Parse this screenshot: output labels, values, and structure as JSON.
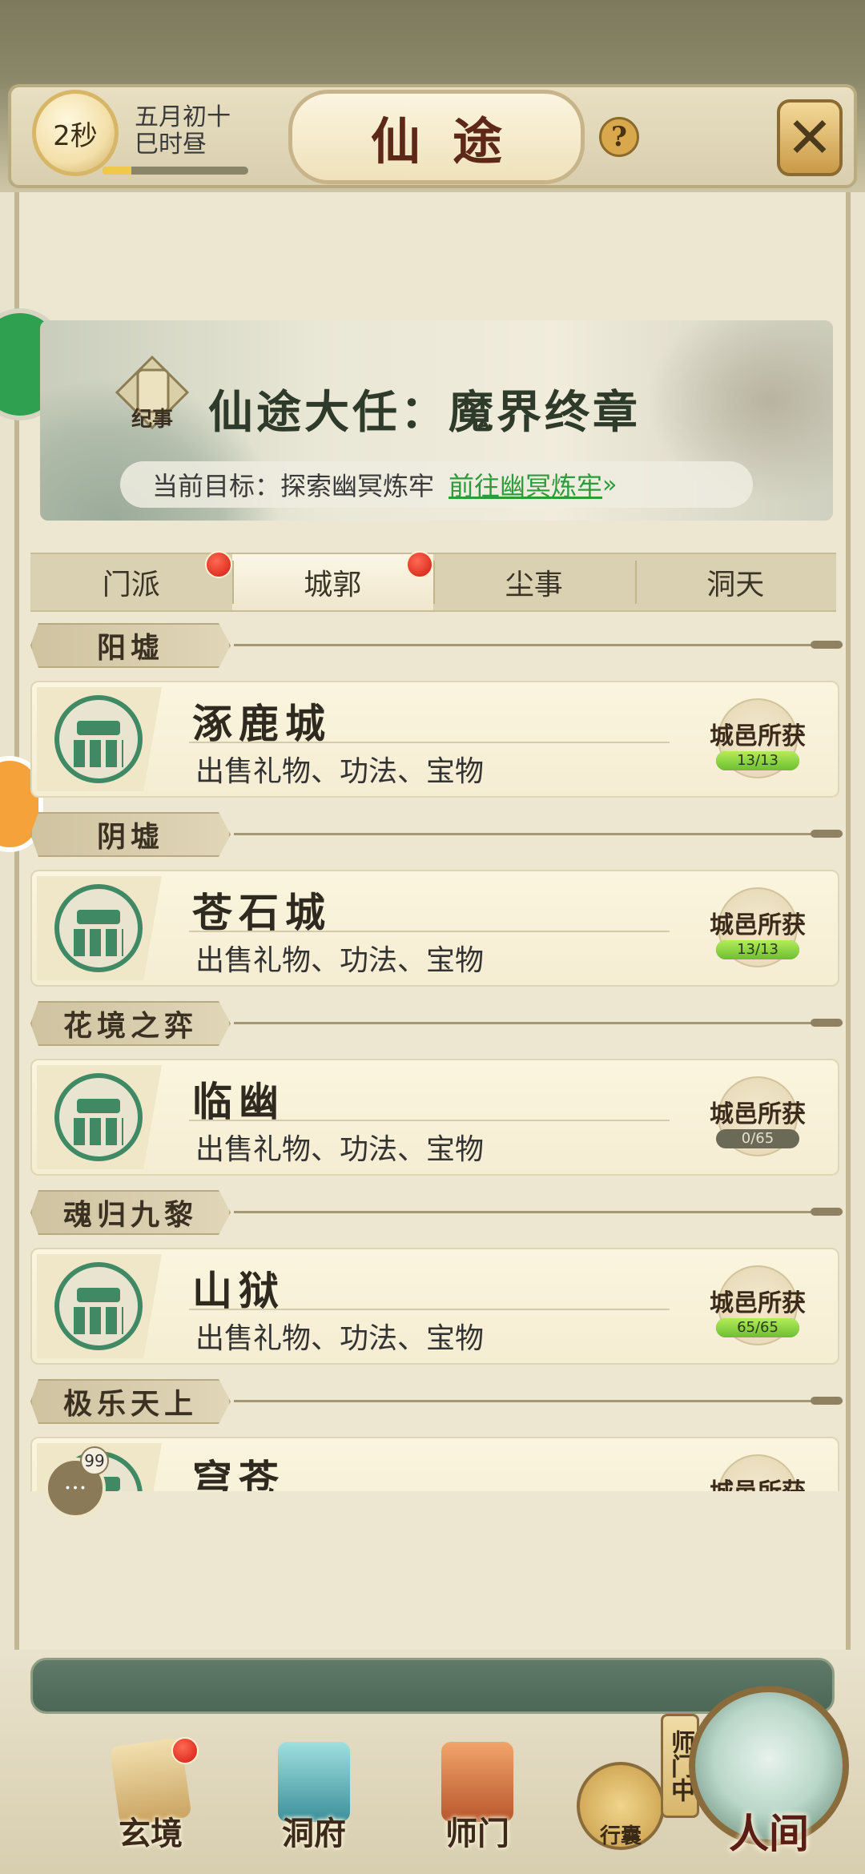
{
  "header": {
    "timer": "2秒",
    "date_line1": "五月初十",
    "date_line2": "巳时昼",
    "time_progress": 0.2,
    "title": "仙途",
    "help_icon": "question-icon",
    "close_icon": "close-icon"
  },
  "banner": {
    "badge": "纪事",
    "title": "仙途大任：魔界终章",
    "goal_label": "当前目标：探索幽冥炼牢",
    "goal_link": "前往幽冥炼牢"
  },
  "tabs": [
    {
      "label": "门派",
      "active": false,
      "dot": true
    },
    {
      "label": "城郭",
      "active": true,
      "dot": true
    },
    {
      "label": "尘事",
      "active": false,
      "dot": false
    },
    {
      "label": "洞天",
      "active": false,
      "dot": false
    }
  ],
  "sections": [
    {
      "name": "阳墟",
      "city": {
        "name": "涿鹿城",
        "desc": "出售礼物、功法、宝物",
        "harvest_label": "城邑所获",
        "harvest_text": "13/13",
        "harvest_fraction": 1.0
      }
    },
    {
      "name": "阴墟",
      "city": {
        "name": "苍石城",
        "desc": "出售礼物、功法、宝物",
        "harvest_label": "城邑所获",
        "harvest_text": "13/13",
        "harvest_fraction": 1.0
      }
    },
    {
      "name": "花境之弈",
      "city": {
        "name": "临幽",
        "desc": "出售礼物、功法、宝物",
        "harvest_label": "城邑所获",
        "harvest_text": "0/65",
        "harvest_fraction": 0.0
      }
    },
    {
      "name": "魂归九黎",
      "city": {
        "name": "山狱",
        "desc": "出售礼物、功法、宝物",
        "harvest_label": "城邑所获",
        "harvest_text": "65/65",
        "harvest_fraction": 1.0
      }
    },
    {
      "name": "极乐天上",
      "city": {
        "name": "穹苍",
        "desc": "",
        "harvest_label": "城邑所获",
        "harvest_text": "",
        "harvest_fraction": 0.0
      }
    }
  ],
  "chat": {
    "count": "99"
  },
  "bottom_nav": {
    "xuanjing": "玄境",
    "dongfu": "洞府",
    "shimen": "师门",
    "bag": "行囊",
    "shimen_status": "师门中",
    "renjian": "人间"
  },
  "colors": {
    "accent_green": "#2c9c3a",
    "title_red": "#5e2818",
    "jade": "#3f8a65"
  }
}
